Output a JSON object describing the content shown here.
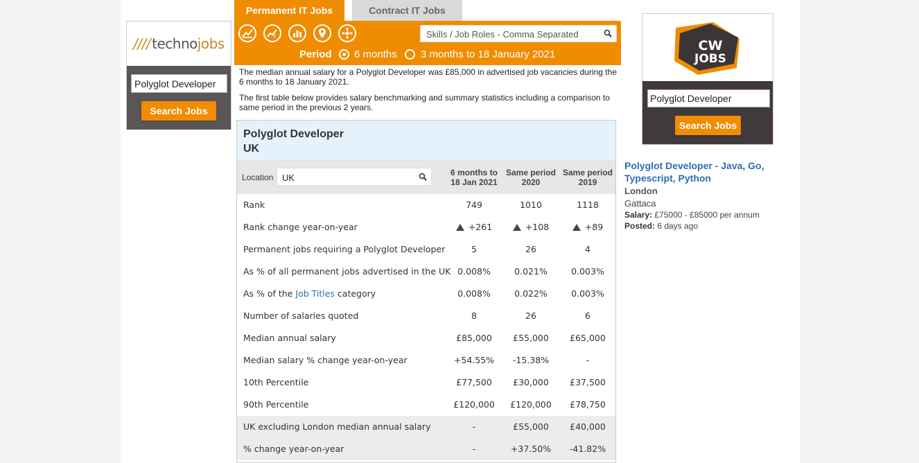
{
  "tabs": [
    {
      "label": "Permanent IT Jobs"
    },
    {
      "label": "Contract IT Jobs"
    }
  ],
  "icons": [
    "trend-chart-icon",
    "salary-trend-icon",
    "bar-chart-icon",
    "location-pin-icon",
    "network-icon"
  ],
  "search": {
    "placeholder": "Skills / Job Roles - Comma Separated"
  },
  "period": {
    "label": "Period",
    "options": [
      "6 months",
      "3 months to 18 January 2021"
    ],
    "selected": "6 months"
  },
  "intro": [
    "The median annual salary for a Polyglot Developer was £85,000 in advertised job vacancies during the 6 months to 18 January 2021.",
    "The first table below provides salary benchmarking and summary statistics including a comparison to same period in the previous 2 years."
  ],
  "left_ad": {
    "logo": {
      "slashes": "////",
      "part1": "techno",
      "part2": "jobs"
    },
    "input_value": "Polyglot Developer",
    "button": "Search Jobs"
  },
  "stats": {
    "title": "Polyglot Developer",
    "subtitle": "UK",
    "location_label": "Location",
    "location_value": "UK",
    "columns": [
      "6 months to 18 Jan 2021",
      "Same period 2020",
      "Same period 2019"
    ],
    "rows": [
      {
        "label": "Rank",
        "values": [
          "749",
          "1010",
          "1118"
        ]
      },
      {
        "label": "Rank change year-on-year",
        "values": [
          "+261",
          "+108",
          "+89"
        ],
        "arrow": true
      },
      {
        "label": "Permanent jobs requiring a Polyglot Developer",
        "values": [
          "5",
          "26",
          "4"
        ]
      },
      {
        "label": "As % of all permanent jobs advertised in the UK",
        "values": [
          "0.008%",
          "0.021%",
          "0.003%"
        ]
      },
      {
        "label_prefix": "As % of the ",
        "label_link": "Job Titles",
        "label_suffix": " category",
        "values": [
          "0.008%",
          "0.022%",
          "0.003%"
        ]
      },
      {
        "label": "Number of salaries quoted",
        "values": [
          "8",
          "26",
          "6"
        ]
      },
      {
        "label": "Median annual salary",
        "values": [
          "£85,000",
          "£55,000",
          "£65,000"
        ]
      },
      {
        "label": "Median salary % change year-on-year",
        "values": [
          "+54.55%",
          "-15.38%",
          "-"
        ]
      },
      {
        "label": "10th Percentile",
        "values": [
          "£77,500",
          "£30,000",
          "£37,500"
        ]
      },
      {
        "label": "90th Percentile",
        "values": [
          "£120,000",
          "£120,000",
          "£78,750"
        ]
      },
      {
        "label": "UK excluding London median annual salary",
        "values": [
          "-",
          "£55,000",
          "£40,000"
        ],
        "shaded": true
      },
      {
        "label": "% change year-on-year",
        "values": [
          "-",
          "+37.50%",
          "-41.82%"
        ],
        "shaded": true
      }
    ]
  },
  "right_ad": {
    "logo_line1": "CW",
    "logo_line2": "JOBS",
    "input_value": "Polyglot Developer",
    "button": "Search Jobs"
  },
  "job": {
    "title": "Polyglot Developer - Java, Go, Typescript, Python",
    "location": "London",
    "company": "Gattaca",
    "salary_label": "Salary:",
    "salary": "£75000 - £85000 per annum",
    "posted_label": "Posted:",
    "posted": "6 days ago"
  },
  "colors": {
    "accent": "#f08c00",
    "link": "#2e6db4",
    "header_bg": "#e6f2fb"
  }
}
